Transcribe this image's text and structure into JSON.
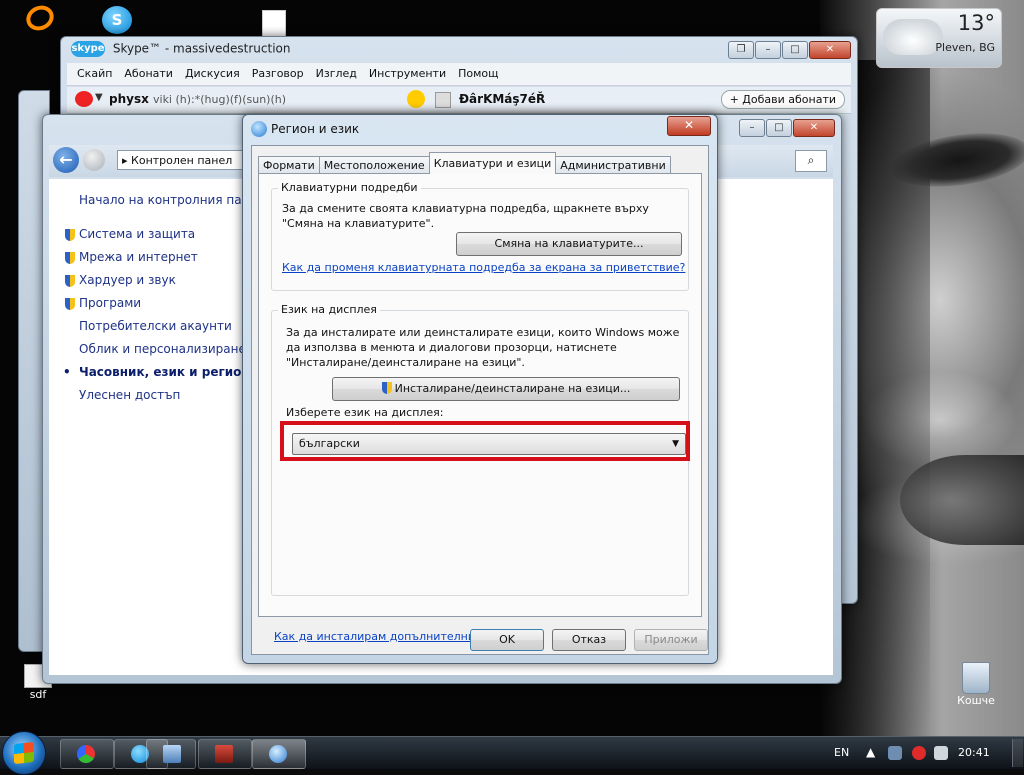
{
  "desktop": {
    "icons": {
      "sdf": "sdf",
      "recycle_bin": "Кошче"
    },
    "weather": {
      "temperature": "13°",
      "city": "Pleven, BG"
    }
  },
  "skype": {
    "title": "Skype™ - massivedestruction",
    "logo": "skype",
    "menu": [
      "Скайп",
      "Абонати",
      "Дискусия",
      "Разговор",
      "Изглед",
      "Инструменти",
      "Помощ"
    ],
    "user": {
      "name": "physx",
      "mood": "viki (h):*(hug)(f)(sun)(h)"
    },
    "contact": "ĐârKMáş7éŘ",
    "add_contacts": "+ Добави абонати"
  },
  "control_panel": {
    "address": "Контролен панел",
    "nav": {
      "home": "Начало на контролния панел",
      "items": [
        "Система и защита",
        "Мрежа и интернет",
        "Хардуер и звук",
        "Програми",
        "Потребителски акаунти",
        "Облик и персонализиране",
        "Часовник, език и регион",
        "Улеснен достъп"
      ],
      "active_index": 6
    }
  },
  "dialog": {
    "title": "Регион и език",
    "tabs": [
      "Формати",
      "Местоположение",
      "Клавиатури и езици",
      "Административни"
    ],
    "active_tab": "Клавиатури и езици",
    "keyboards": {
      "group_title": "Клавиатурни подредби",
      "description": "За да смените своята клавиатурна подредба, щракнете върху \"Смяна на клавиатурите\".",
      "button": "Смяна на клавиатурите...",
      "link": "Как да променя клавиатурната подредба за екрана за приветствие?"
    },
    "display_language": {
      "group_title": "Език на дисплея",
      "description": "За да инсталирате или деинсталирате езици, които Windows може да използва в менюта и диалогови прозорци, натиснете \"Инсталиране/деинсталиране на езици\".",
      "button": "Инсталиране/деинсталиране на езици...",
      "choose_label": "Изберете език на дисплея:",
      "selected": "български"
    },
    "more_link": "Как да инсталирам допълнителни езици?",
    "buttons": {
      "ok": "OK",
      "cancel": "Отказ",
      "apply": "Приложи"
    }
  },
  "taskbar": {
    "language": "EN",
    "clock": "20:41"
  },
  "colors": {
    "highlight": "#d6101b",
    "link": "#0b42c4",
    "nav_link": "#1e3287"
  }
}
